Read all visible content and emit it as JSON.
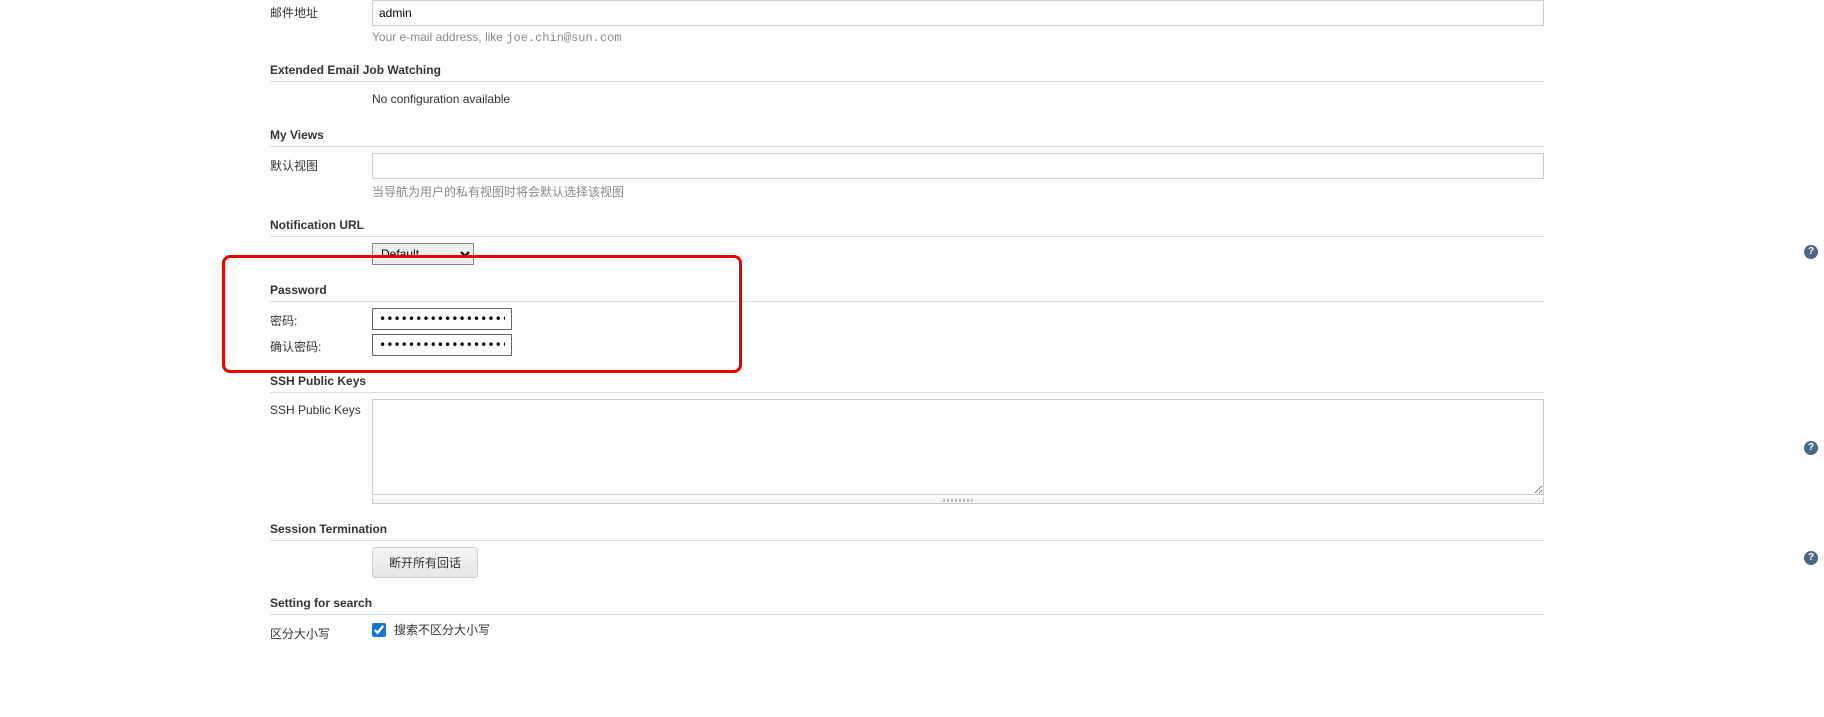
{
  "email": {
    "label": "邮件地址",
    "value": "admin",
    "help_pre": "Your e-mail address, like ",
    "help_code": "joe.chin@sun.com"
  },
  "extended_email": {
    "header": "Extended Email Job Watching",
    "no_config": "No configuration available"
  },
  "my_views": {
    "header": "My Views",
    "default_view_label": "默认视图",
    "default_view_value": "",
    "help": "当导航为用户的私有视图时将会默认选择该视图"
  },
  "notification_url": {
    "header": "Notification URL",
    "select_value": "Default"
  },
  "password": {
    "header": "Password",
    "label": "密码:",
    "confirm_label": "确认密码:",
    "value": "••••••••••••••••••••••••",
    "confirm_value": "••••••••••••••••••••••••"
  },
  "ssh": {
    "header": "SSH Public Keys",
    "label": "SSH Public Keys",
    "value": ""
  },
  "session": {
    "header": "Session Termination",
    "button": "断开所有回话"
  },
  "search": {
    "header": "Setting for search",
    "label": "区分大小写",
    "checkbox_label": "搜索不区分大小写",
    "checked": true
  }
}
